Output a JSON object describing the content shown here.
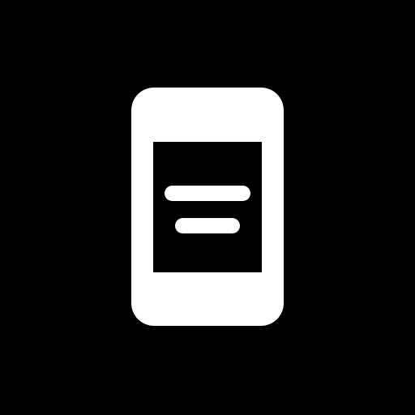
{
  "icon": {
    "name": "phone-notes-icon",
    "colors": {
      "background": "#000000",
      "device": "#ffffff",
      "screen": "#000000",
      "text_lines": "#ffffff"
    }
  }
}
